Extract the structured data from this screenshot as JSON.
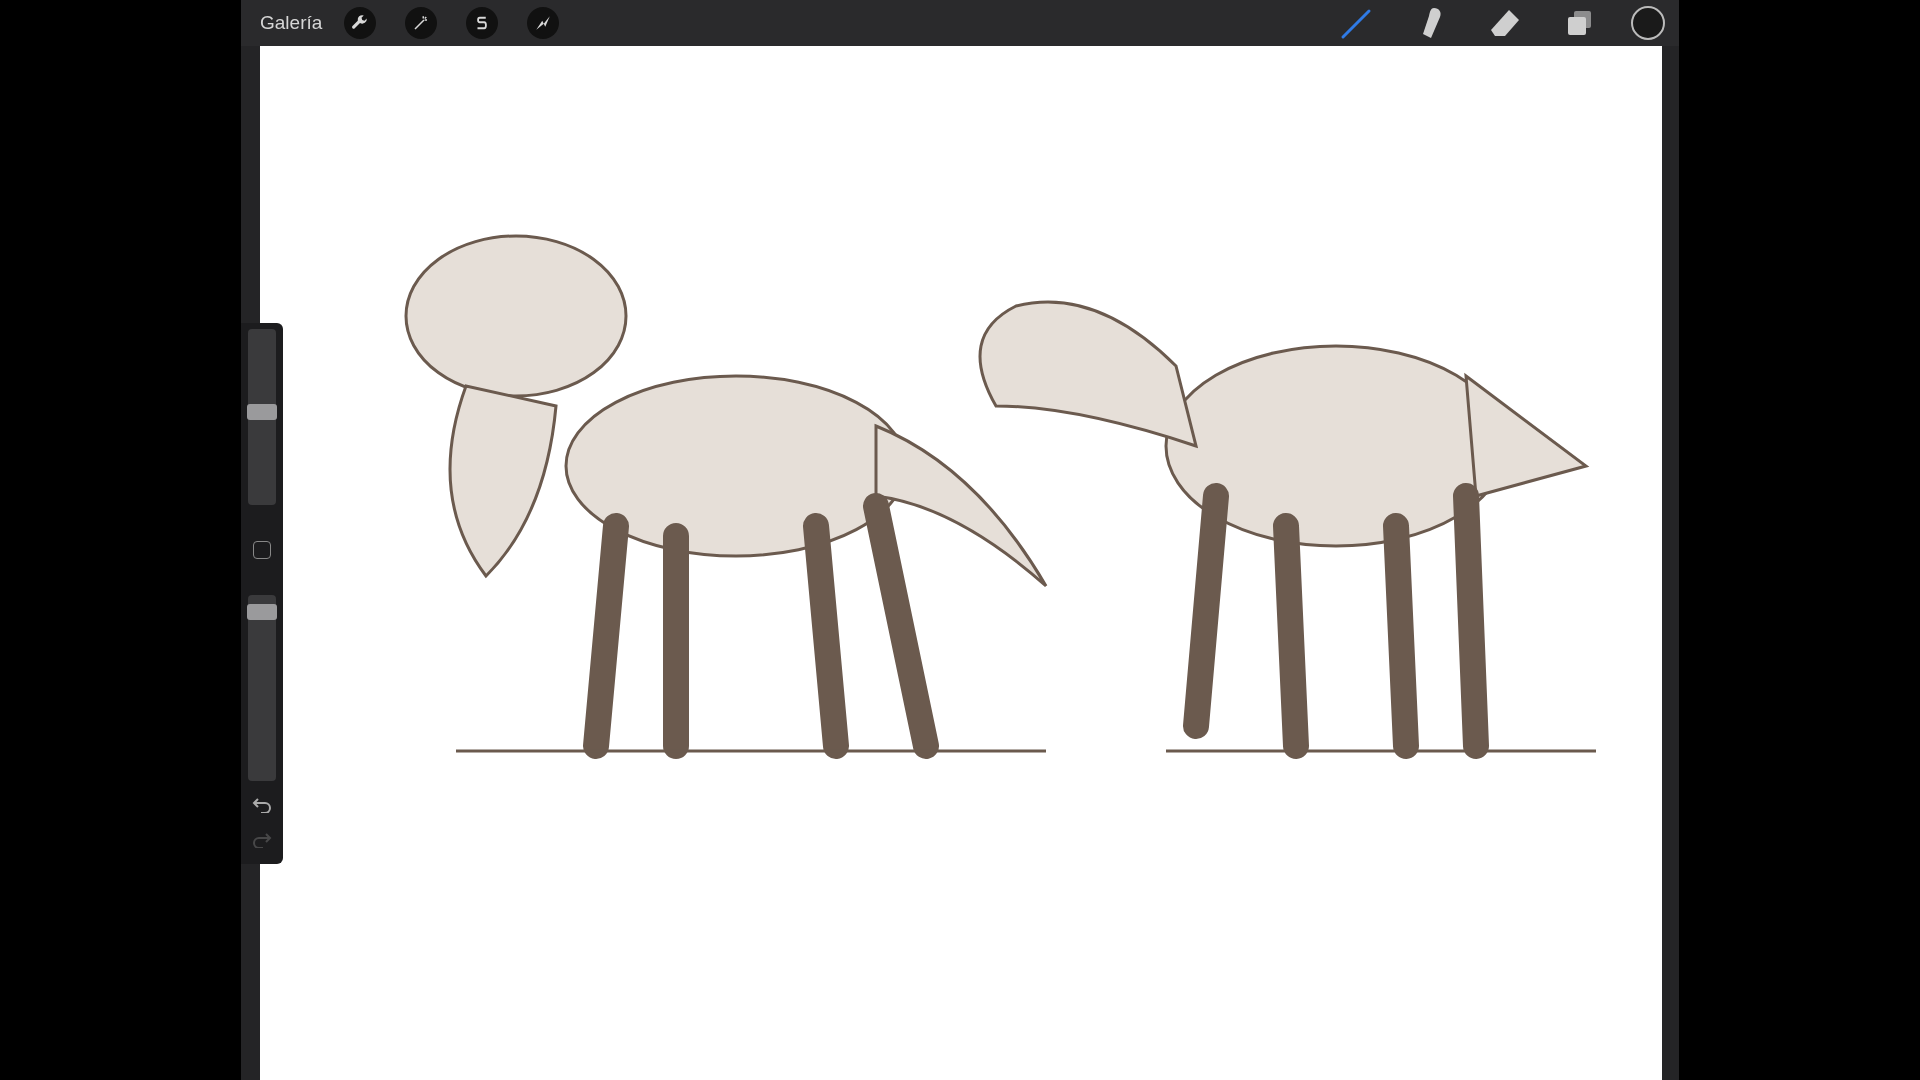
{
  "top_bar": {
    "gallery": "Galería",
    "actions": [
      {
        "kind": "wrench",
        "selected": false
      },
      {
        "kind": "wand",
        "selected": false
      },
      {
        "kind": "selection",
        "selected": false
      },
      {
        "kind": "transform",
        "selected": false
      }
    ],
    "tools": [
      {
        "kind": "brush",
        "selected": true
      },
      {
        "kind": "smudge",
        "selected": false
      },
      {
        "kind": "eraser",
        "selected": false
      },
      {
        "kind": "layers",
        "selected": false
      }
    ],
    "color": "#1a1a1a"
  },
  "sidebar": {
    "sliders": [
      {
        "kind": "size",
        "level": 0.53
      },
      {
        "kind": "opacity",
        "level": 0.91
      }
    ],
    "undo": {
      "disabled": false
    },
    "redo": {
      "disabled": true
    }
  }
}
